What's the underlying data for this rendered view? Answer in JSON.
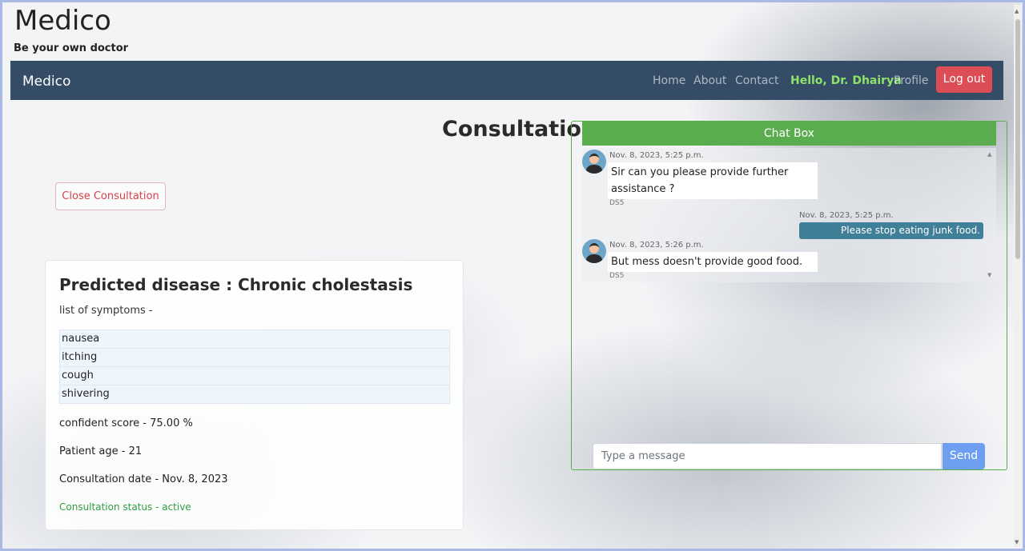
{
  "brand": {
    "title": "Medico",
    "tagline": "Be your own doctor"
  },
  "navbar": {
    "brand": "Medico",
    "links": [
      "Home",
      "About",
      "Contact"
    ],
    "greeting": "Hello, Dr. Dhairya",
    "profile": "Profile",
    "logout": "Log out"
  },
  "page": {
    "heading": "Consultation",
    "close_button": "Close Consultation"
  },
  "prediction": {
    "title": "Predicted disease : Chronic cholestasis",
    "symptoms_label": "list of symptoms -",
    "symptoms": [
      "nausea",
      "itching",
      "cough",
      "shivering"
    ],
    "confidence": "confident score - 75.00 %",
    "age": "Patient age - 21",
    "date": "Consultation date - Nov. 8, 2023",
    "status": "Consultation status - active"
  },
  "chat": {
    "title": "Chat Box",
    "messages": [
      {
        "time": "Nov. 8, 2023, 5:25 p.m.",
        "text": "Sir can you please provide further assistance ?",
        "sender": "DS5"
      },
      {
        "time": "Nov. 8, 2023, 5:25 p.m.",
        "text": "Please stop eating junk food."
      },
      {
        "time": "Nov. 8, 2023, 5:26 p.m.",
        "text": "But mess doesn't provide good food.",
        "sender": "DS5"
      }
    ],
    "input_placeholder": "Type a message",
    "send": "Send"
  }
}
